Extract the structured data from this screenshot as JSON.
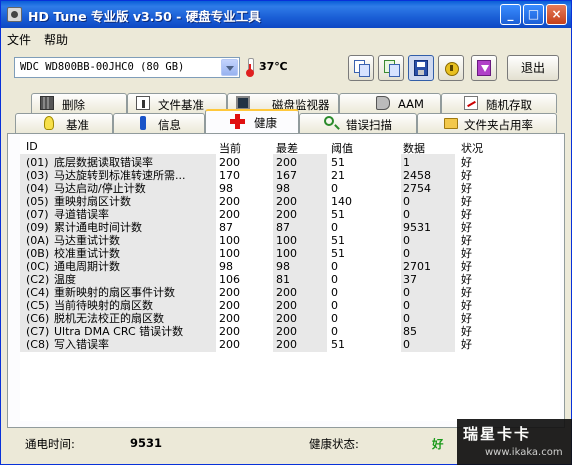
{
  "window": {
    "title": "HD Tune 专业版 v3.50 - 硬盘专业工具"
  },
  "menu": {
    "file": "文件",
    "help": "帮助"
  },
  "toolbar": {
    "drive": "WDC WD800BB-00JHC0 (80 GB)",
    "temperature": "37℃",
    "exit_label": "退出"
  },
  "tabs": {
    "delete": "删除",
    "file_benchmark": "文件基准",
    "disk_monitor": "磁盘监视器",
    "aam": "AAM",
    "random_access": "随机存取",
    "benchmark": "基准",
    "info": "信息",
    "health": "健康",
    "error_scan": "错误扫描",
    "folder_usage": "文件夹占用率"
  },
  "table": {
    "headers": {
      "id": "ID",
      "current": "当前",
      "worst": "最差",
      "threshold": "阈值",
      "data": "数据",
      "status": "状况"
    },
    "rows": [
      {
        "id": "(01)",
        "name": "底层数据读取错误率",
        "current": "200",
        "worst": "200",
        "threshold": "51",
        "data": "1",
        "status": "好"
      },
      {
        "id": "(03)",
        "name": "马达旋转到标准转速所需...",
        "current": "170",
        "worst": "167",
        "threshold": "21",
        "data": "2458",
        "status": "好"
      },
      {
        "id": "(04)",
        "name": "马达启动/停止计数",
        "current": "98",
        "worst": "98",
        "threshold": "0",
        "data": "2754",
        "status": "好"
      },
      {
        "id": "(05)",
        "name": "重映射扇区计数",
        "current": "200",
        "worst": "200",
        "threshold": "140",
        "data": "0",
        "status": "好"
      },
      {
        "id": "(07)",
        "name": "寻道错误率",
        "current": "200",
        "worst": "200",
        "threshold": "51",
        "data": "0",
        "status": "好"
      },
      {
        "id": "(09)",
        "name": "累计通电时间计数",
        "current": "87",
        "worst": "87",
        "threshold": "0",
        "data": "9531",
        "status": "好"
      },
      {
        "id": "(0A)",
        "name": "马达重试计数",
        "current": "100",
        "worst": "100",
        "threshold": "51",
        "data": "0",
        "status": "好"
      },
      {
        "id": "(0B)",
        "name": "校准重试计数",
        "current": "100",
        "worst": "100",
        "threshold": "51",
        "data": "0",
        "status": "好"
      },
      {
        "id": "(0C)",
        "name": "通电周期计数",
        "current": "98",
        "worst": "98",
        "threshold": "0",
        "data": "2701",
        "status": "好"
      },
      {
        "id": "(C2)",
        "name": "温度",
        "current": "106",
        "worst": "81",
        "threshold": "0",
        "data": "37",
        "status": "好"
      },
      {
        "id": "(C4)",
        "name": "重新映射的扇区事件计数",
        "current": "200",
        "worst": "200",
        "threshold": "0",
        "data": "0",
        "status": "好"
      },
      {
        "id": "(C5)",
        "name": "当前待映射的扇区数",
        "current": "200",
        "worst": "200",
        "threshold": "0",
        "data": "0",
        "status": "好"
      },
      {
        "id": "(C6)",
        "name": "脱机无法校正的扇区数",
        "current": "200",
        "worst": "200",
        "threshold": "0",
        "data": "0",
        "status": "好"
      },
      {
        "id": "(C7)",
        "name": "Ultra DMA CRC 错误计数",
        "current": "200",
        "worst": "200",
        "threshold": "0",
        "data": "85",
        "status": "好"
      },
      {
        "id": "(C8)",
        "name": "写入错误率",
        "current": "200",
        "worst": "200",
        "threshold": "51",
        "data": "0",
        "status": "好"
      }
    ]
  },
  "footer": {
    "power_on_label": "通电时间:",
    "power_on_value": "9531",
    "health_label": "健康状态:",
    "health_value": "好"
  },
  "watermark": {
    "title": "瑞星卡卡",
    "url": "www.ikaka.com"
  },
  "colors": {
    "title_bar": "#1b5fd6",
    "health_ok": "#1a9a1a",
    "active_tab_accent": "#ffc83c",
    "window_bg": "#ece9d8"
  },
  "icons": {
    "app": "hd-tune-app-icon",
    "thermometer": "thermometer-icon",
    "delete": "trash-icon",
    "file_benchmark": "info-icon",
    "disk_monitor": "monitor-icon",
    "aam": "speaker-icon",
    "random_access": "graph-icon",
    "benchmark": "bulb-icon",
    "info": "info-icon",
    "health": "red-cross-icon",
    "error_scan": "magnifier-icon",
    "folder_usage": "folder-icon"
  }
}
